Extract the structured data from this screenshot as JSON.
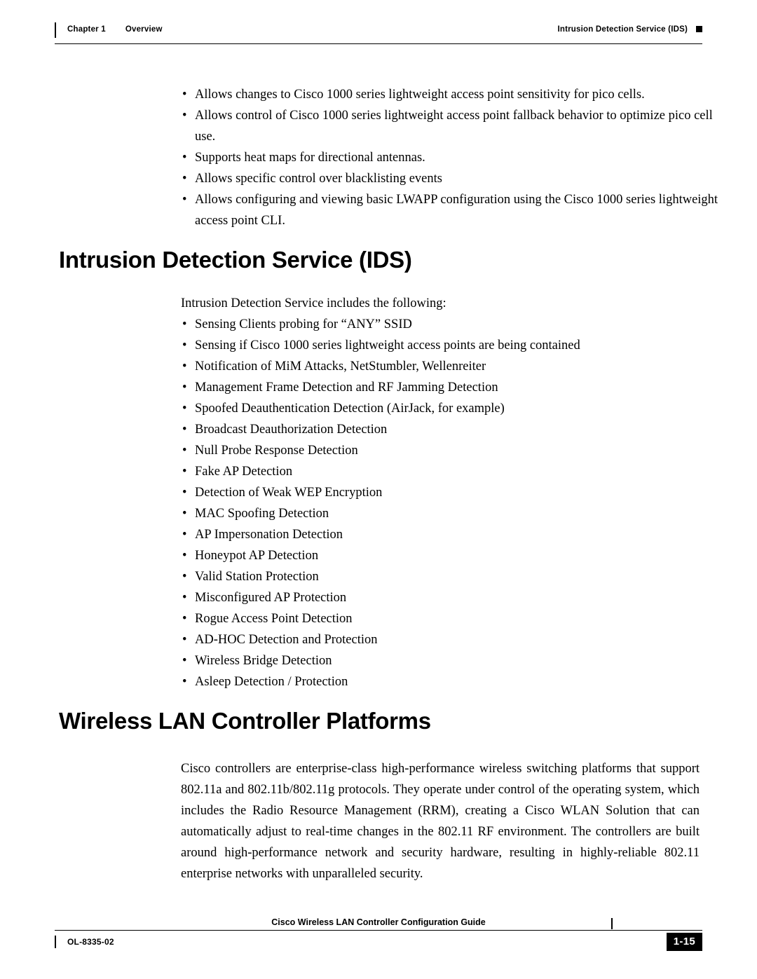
{
  "header": {
    "chapter": "Chapter 1",
    "section": "Overview",
    "running_head": "Intrusion Detection Service (IDS)"
  },
  "intro_bullets": [
    "Allows changes to Cisco 1000 series lightweight access point sensitivity for pico cells.",
    "Allows control of Cisco 1000 series lightweight access point fallback behavior to optimize pico cell use.",
    "Supports heat maps for directional antennas.",
    "Allows specific control over blacklisting events",
    "Allows configuring and viewing basic LWAPP configuration using the Cisco 1000 series lightweight access point CLI."
  ],
  "ids": {
    "heading": "Intrusion Detection Service (IDS)",
    "intro": "Intrusion Detection Service includes the following:",
    "bullets": [
      "Sensing Clients probing for “ANY” SSID",
      "Sensing if Cisco 1000 series lightweight access points are being contained",
      "Notification of MiM Attacks, NetStumbler, Wellenreiter",
      "Management Frame Detection and RF Jamming Detection",
      "Spoofed Deauthentication Detection (AirJack, for example)",
      "Broadcast Deauthorization Detection",
      "Null Probe Response Detection",
      "Fake AP Detection",
      "Detection of Weak WEP Encryption",
      "MAC Spoofing Detection",
      "AP Impersonation Detection",
      "Honeypot AP Detection",
      "Valid Station Protection",
      "Misconfigured AP Protection",
      "Rogue Access Point Detection",
      "AD-HOC Detection and Protection",
      "Wireless Bridge Detection",
      "Asleep Detection / Protection"
    ]
  },
  "wlan_controller": {
    "heading": "Wireless LAN Controller Platforms",
    "paragraph": "Cisco controllers are enterprise-class high-performance wireless switching platforms that support 802.11a and 802.11b/802.11g protocols. They operate under control of the operating system, which includes the Radio Resource Management (RRM), creating a Cisco WLAN Solution that can automatically adjust to real-time changes in the 802.11 RF environment. The controllers are built around high-performance network and security hardware, resulting in highly-reliable 802.11 enterprise networks with unparalleled security."
  },
  "footer": {
    "doc_title": "Cisco Wireless LAN Controller Configuration Guide",
    "doc_number": "OL-8335-02",
    "page_number": "1-15"
  },
  "bullet_glyph": "•"
}
